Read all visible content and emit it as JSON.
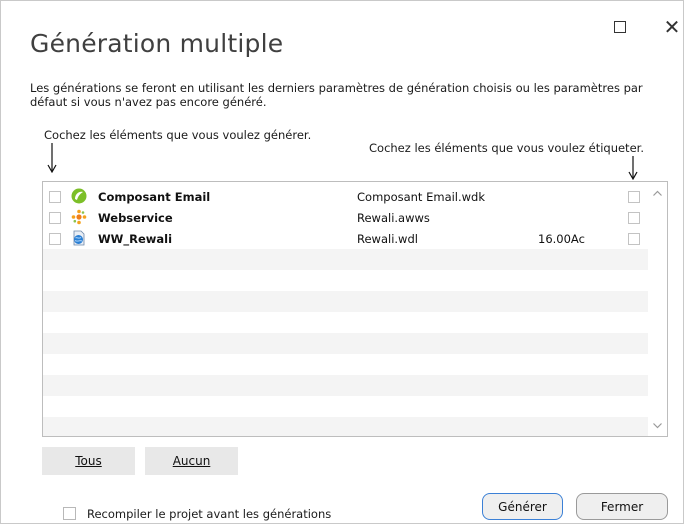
{
  "window": {
    "title": "Génération multiple",
    "maximize_icon": "maximize-icon",
    "close_icon": "close-icon",
    "close_glyph": "✕"
  },
  "description": "Les générations se feront en utilisant les derniers paramètres de génération choisis ou les paramètres par défaut si vous n'avez pas encore généré.",
  "hints": {
    "generate": "Cochez les éléments que vous voulez générer.",
    "label": "Cochez les éléments que vous voulez étiqueter."
  },
  "items": [
    {
      "name": "Composant Email",
      "file": "Composant Email.wdk",
      "version": "",
      "icon": "component-icon",
      "generate": false,
      "label": false
    },
    {
      "name": "Webservice",
      "file": "Rewali.awws",
      "version": "",
      "icon": "webservice-icon",
      "generate": false,
      "label": false
    },
    {
      "name": "WW_Rewali",
      "file": "Rewali.wdl",
      "version": "16.00Ac",
      "icon": "web-project-icon",
      "generate": false,
      "label": false
    }
  ],
  "buttons": {
    "all": "Tous",
    "none": "Aucun",
    "generate": "Générer",
    "close": "Fermer"
  },
  "options": {
    "recompile_label": "Recompiler le projet avant les générations",
    "recompile_checked": false
  },
  "colors": {
    "accent_border": "#3b80d6",
    "button_bg": "#e8e8e8",
    "alt_row": "#f4f4f4"
  }
}
